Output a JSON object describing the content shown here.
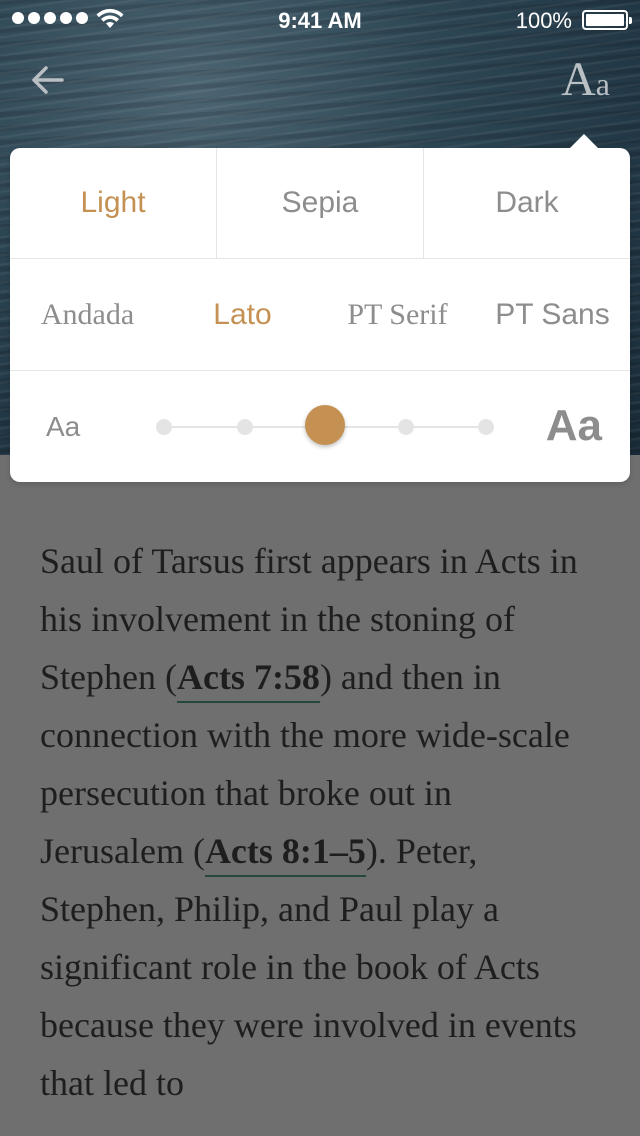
{
  "status_bar": {
    "time": "9:41 AM",
    "battery_percent": "100%",
    "signal_bars": 5
  },
  "header": {
    "back_icon": "arrow-left-icon",
    "font_settings_big": "A",
    "font_settings_small": "a"
  },
  "settings": {
    "themes": [
      {
        "label": "Light",
        "active": true
      },
      {
        "label": "Sepia",
        "active": false
      },
      {
        "label": "Dark",
        "active": false
      }
    ],
    "fonts": [
      {
        "label": "Andada",
        "active": false
      },
      {
        "label": "Lato",
        "active": true
      },
      {
        "label": "PT Serif",
        "active": false
      },
      {
        "label": "PT Sans",
        "active": false
      }
    ],
    "size": {
      "small_label": "Aa",
      "large_label": "Aa",
      "steps": 5,
      "selected_step": 3
    },
    "accent_color": "#c49152"
  },
  "article": {
    "p1_before_ref1": "Saul of Tarsus first appears in Acts in his involvement in the stoning of Stephen (",
    "ref1": "Acts 7:58",
    "p1_after_ref1": ") and then in connection with the more wide-scale persecution that broke out in Jerusalem (",
    "ref2": "Acts 8:1–5",
    "p1_after_ref2": "). Peter, Stephen, Philip, and Paul play a significant role in the book of Acts because they were involved in events that led to"
  }
}
